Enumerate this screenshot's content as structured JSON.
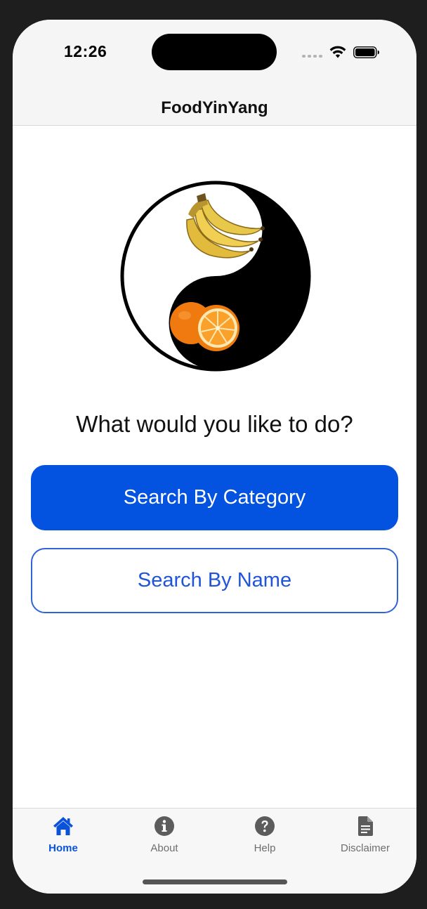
{
  "status_bar": {
    "time": "12:26"
  },
  "nav": {
    "title": "FoodYinYang"
  },
  "main": {
    "prompt": "What would you like to do?",
    "primary_button_label": "Search By Category",
    "secondary_button_label": "Search By Name"
  },
  "tabbar": {
    "tabs": [
      {
        "label": "Home",
        "icon": "house-icon",
        "active": true
      },
      {
        "label": "About",
        "icon": "info-circle-icon",
        "active": false
      },
      {
        "label": "Help",
        "icon": "question-circle-icon",
        "active": false
      },
      {
        "label": "Disclaimer",
        "icon": "document-icon",
        "active": false
      }
    ]
  },
  "colors": {
    "accent": "#0452e0",
    "tab_active": "#0a52d9",
    "tab_inactive": "#6e6e6e",
    "background": "#1e1e1e"
  }
}
